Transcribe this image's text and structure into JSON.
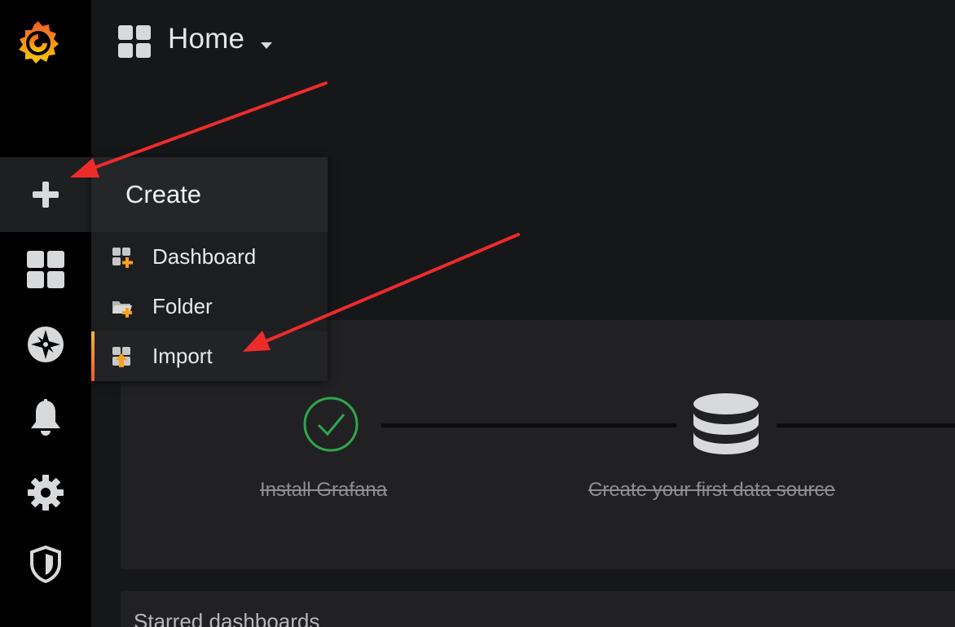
{
  "navbar": {
    "title": "Home"
  },
  "sidemenu": {
    "items": [
      {
        "icon": "grafana-logo-icon"
      },
      {
        "icon": "plus-icon",
        "active": true
      },
      {
        "icon": "dashboards-grid-icon"
      },
      {
        "icon": "compass-explore-icon"
      },
      {
        "icon": "bell-alerting-icon"
      },
      {
        "icon": "gear-configuration-icon"
      },
      {
        "icon": "shield-admin-icon"
      }
    ]
  },
  "create_menu": {
    "header": "Create",
    "items": [
      {
        "label": "Dashboard",
        "icon": "dashboard-add-icon"
      },
      {
        "label": "Folder",
        "icon": "folder-add-icon"
      },
      {
        "label": "Import",
        "icon": "import-icon",
        "active": true
      }
    ]
  },
  "getting_started": {
    "steps": [
      {
        "label": "Install Grafana",
        "done": true,
        "icon": "check-circle-icon"
      },
      {
        "label": "Create your first data source",
        "done": true,
        "icon": "database-icon"
      }
    ]
  },
  "starred": {
    "title": "Starred dashboards"
  },
  "colors": {
    "background": "#161719",
    "sidemenu": "#000000",
    "panel": "#212124",
    "accent_orange": "#f05a28",
    "accent_yellow": "#ffb33a",
    "success_green": "#2ea84a",
    "annotation_red": "#ee2b2b"
  }
}
